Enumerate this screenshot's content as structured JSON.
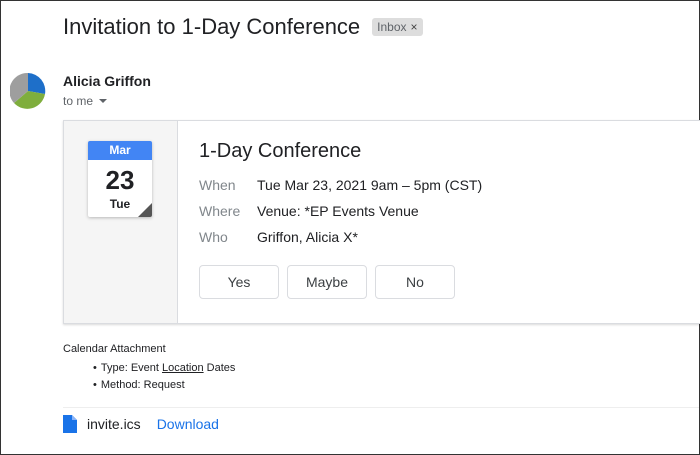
{
  "message": {
    "subject": "Invitation to 1-Day Conference",
    "label": "Inbox",
    "label_remove": "×",
    "sender": "Alicia Griffon",
    "recipient": "to me"
  },
  "event": {
    "calendar_month": "Mar",
    "calendar_day": "23",
    "calendar_weekday": "Tue",
    "title": "1-Day Conference",
    "details": [
      {
        "label": "When",
        "value": "Tue Mar 23, 2021 9am – 5pm (CST)"
      },
      {
        "label": "Where",
        "value": "Venue: *EP Events Venue"
      },
      {
        "label": "Who",
        "value": "Griffon, Alicia X*"
      }
    ],
    "rsvp": {
      "yes": "Yes",
      "maybe": "Maybe",
      "no": "No"
    }
  },
  "attachment": {
    "heading": "Calendar Attachment",
    "bullets": {
      "type_prefix": "Type: Event ",
      "type_link": "Location",
      "type_suffix": " Dates",
      "method": "Method: Request"
    },
    "file_name": "invite.ics",
    "download_label": "Download",
    "file_icon": "document-icon"
  },
  "colors": {
    "accent": "#4285f4",
    "link": "#1a73e8"
  }
}
